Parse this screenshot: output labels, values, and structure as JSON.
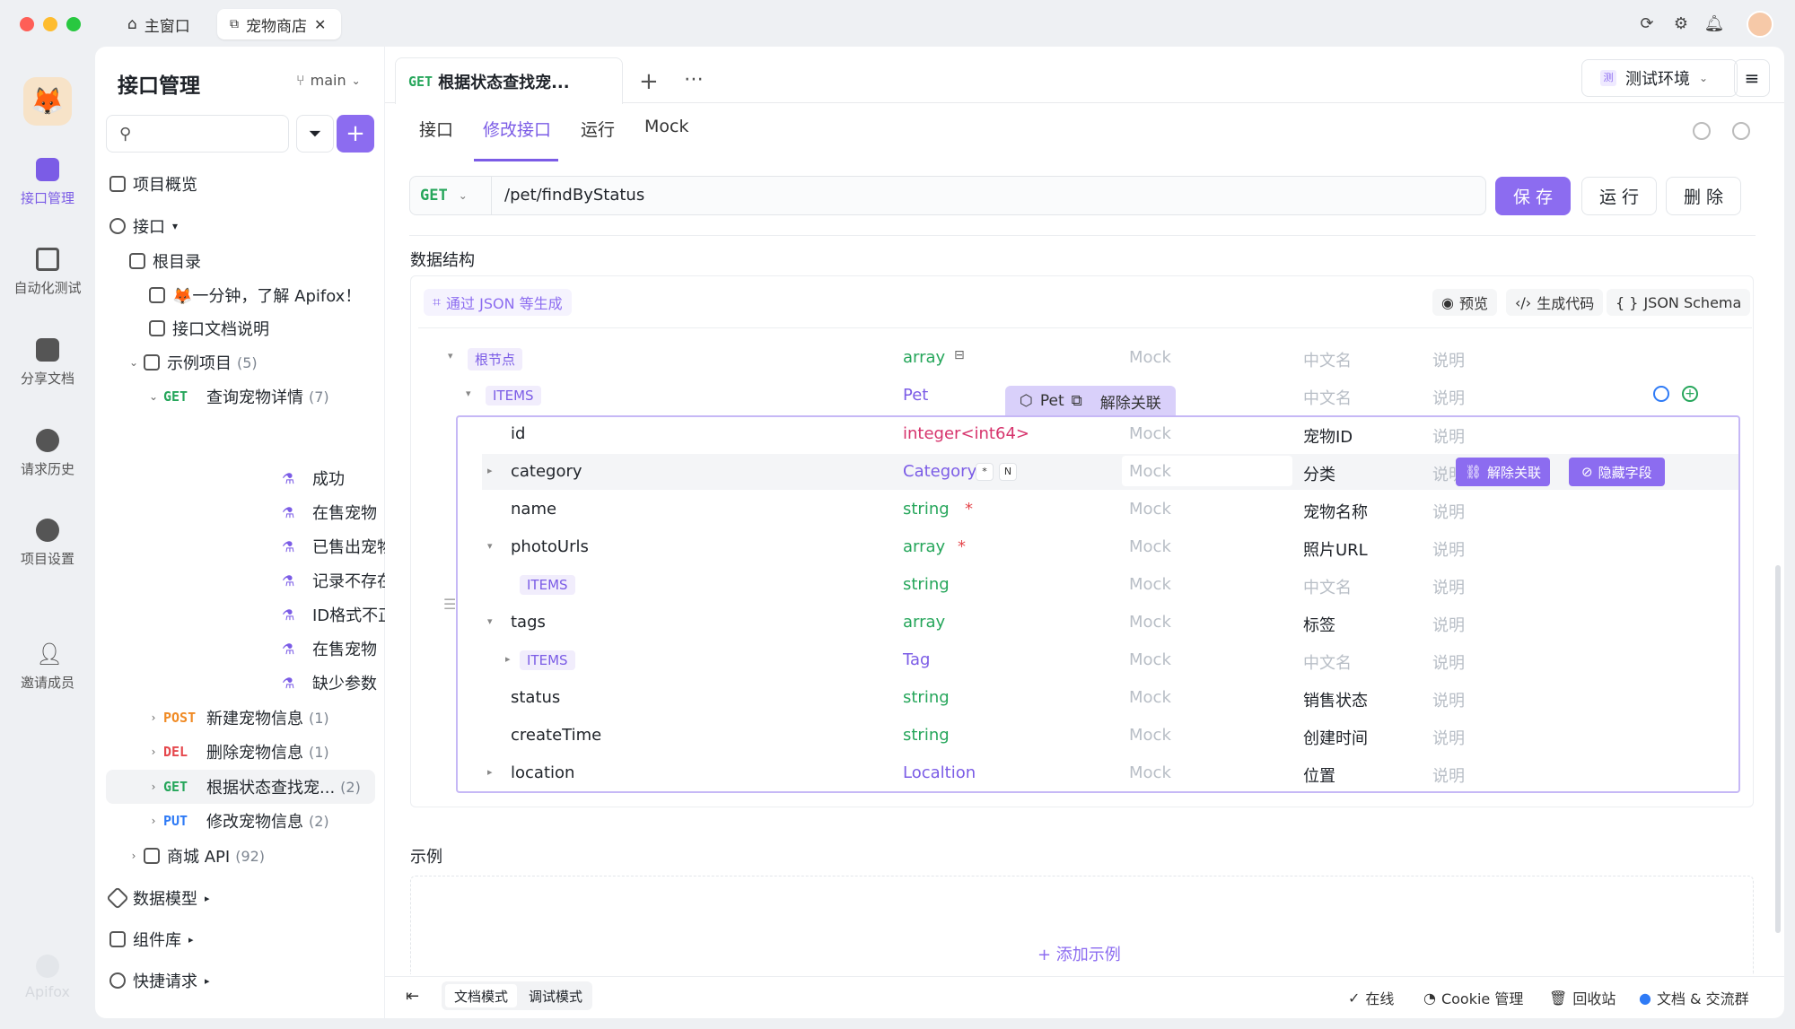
{
  "titlebar": {
    "home_tab": "主窗口",
    "project_tab": "宠物商店"
  },
  "rail": {
    "items": [
      "接口管理",
      "自动化测试",
      "分享文档",
      "请求历史",
      "项目设置",
      "邀请成员"
    ],
    "brand": "Apifox"
  },
  "sidebar": {
    "title": "接口管理",
    "branch": "main",
    "search_placeholder": "",
    "overview": "项目概览",
    "apis": "接口",
    "root": "根目录",
    "doc1": "🦊一分钟，了解 Apifox！",
    "doc2": "接口文档说明",
    "example_folder": "示例项目",
    "example_count": "(5)",
    "get_detail_method": "GET",
    "get_detail_name": "查询宠物详情",
    "get_detail_count": "(7)",
    "cases": [
      "成功",
      "在售宠物",
      "已售出宠物",
      "记录不存在",
      "ID格式不正确",
      "在售宠物",
      "缺少参数"
    ],
    "post_method": "POST",
    "post_name": "新建宠物信息",
    "post_count": "(1)",
    "del_method": "DEL",
    "del_name": "删除宠物信息",
    "del_count": "(1)",
    "find_method": "GET",
    "find_name": "根据状态查找宠...",
    "find_count": "(2)",
    "put_method": "PUT",
    "put_name": "修改宠物信息",
    "put_count": "(2)",
    "shop_folder": "商城 API",
    "shop_count": "(92)",
    "models": "数据模型",
    "components": "组件库",
    "quick": "快捷请求"
  },
  "main": {
    "doc_tab_method": "GET",
    "doc_tab_title": "根据状态查找宠...",
    "env": "测试环境",
    "env_badge": "测",
    "subtabs": [
      "接口",
      "修改接口",
      "运行",
      "Mock"
    ],
    "method": "GET",
    "url": "/pet/findByStatus",
    "save": "保 存",
    "run": "运 行",
    "delete": "删 除",
    "section_schema": "数据结构",
    "gen_from_json": "通过 JSON 等生成",
    "preview": "预览",
    "gen_code": "生成代码",
    "json_schema": "JSON Schema",
    "root_node": "根节点",
    "root_type": "array",
    "items_label": "ITEMS",
    "items_type": "Pet",
    "pet_ref": "Pet",
    "unlink": "解除关联",
    "mock_ph": "Mock",
    "cn_ph": "中文名",
    "desc_ph": "说明",
    "unlink_btn": "解除关联",
    "hide_btn": "隐藏字段",
    "fields": [
      {
        "name": "id",
        "type": "integer<int64>",
        "cn": "宠物ID"
      },
      {
        "name": "category",
        "type": "Category",
        "cn": "分类",
        "badge1": "*",
        "badge2": "N"
      },
      {
        "name": "name",
        "type": "string",
        "cn": "宠物名称",
        "req": "*"
      },
      {
        "name": "photoUrls",
        "type": "array",
        "cn": "照片URL",
        "req": "*"
      },
      {
        "name": "ITEMS",
        "type": "string",
        "cn": "中文名"
      },
      {
        "name": "tags",
        "type": "array",
        "cn": "标签"
      },
      {
        "name": "ITEMS",
        "type": "Tag",
        "cn": "中文名"
      },
      {
        "name": "status",
        "type": "string",
        "cn": "销售状态"
      },
      {
        "name": "createTime",
        "type": "string",
        "cn": "创建时间"
      },
      {
        "name": "location",
        "type": "Localtion",
        "cn": "位置"
      }
    ],
    "section_example": "示例",
    "add_example": "+ 添加示例"
  },
  "footer": {
    "doc_mode": "文档模式",
    "debug_mode": "调试模式",
    "online": "在线",
    "cookie": "Cookie 管理",
    "trash": "回收站",
    "community": "文档 & 交流群"
  },
  "colors": {
    "accent": "#7b5ce6",
    "get": "#26a65b",
    "post": "#f08a24",
    "del": "#e5484d",
    "put": "#2f7bf6"
  }
}
